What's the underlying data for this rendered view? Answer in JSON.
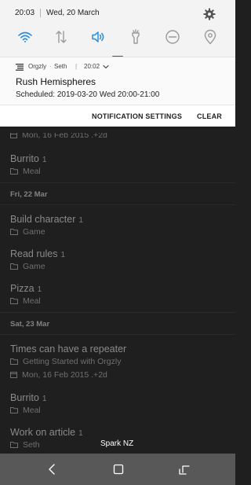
{
  "status_bar": {
    "time": "20:03",
    "date": "Wed, 20 March"
  },
  "quick_toggles": [
    {
      "name": "wifi",
      "active": true
    },
    {
      "name": "mobile-data",
      "active": false
    },
    {
      "name": "sound",
      "active": true
    },
    {
      "name": "flashlight",
      "active": false
    },
    {
      "name": "do-not-disturb",
      "active": false
    },
    {
      "name": "location",
      "active": false
    }
  ],
  "notification": {
    "app": "Orgzly",
    "account": "Seth",
    "time": "20:02",
    "title": "Rush Hemispheres",
    "body": "Scheduled: 2019-03-20 Wed 20:00-21:00"
  },
  "notification_actions": {
    "settings": "NOTIFICATION SETTINGS",
    "clear": "CLEAR"
  },
  "list": {
    "partial_meta": "Mon, 16 Feb 2015 .+2d",
    "item_burrito_1": {
      "title": "Burrito",
      "count": "1",
      "book": "Meal"
    },
    "header_fri": "Fri, 22 Mar",
    "item_build": {
      "title": "Build character",
      "count": "1",
      "book": "Game"
    },
    "item_rules": {
      "title": "Read rules",
      "count": "1",
      "book": "Game"
    },
    "item_pizza": {
      "title": "Pizza",
      "count": "1",
      "book": "Meal"
    },
    "header_sat": "Sat, 23 Mar",
    "item_times": {
      "title": "Times can have a repeater",
      "book": "Getting Started with Orgzly",
      "scheduled": "Mon, 16 Feb 2015 .+2d"
    },
    "item_burrito_2": {
      "title": "Burrito",
      "count": "1",
      "book": "Meal"
    },
    "item_article": {
      "title": "Work on article",
      "count": "1",
      "book": "Seth"
    }
  },
  "carrier": "Spark NZ",
  "colors": {
    "accent": "#2b8fdc",
    "shade_bg": "#f3f3f3",
    "list_bg": "#1f1f1f",
    "navbar_bg": "#585858"
  }
}
